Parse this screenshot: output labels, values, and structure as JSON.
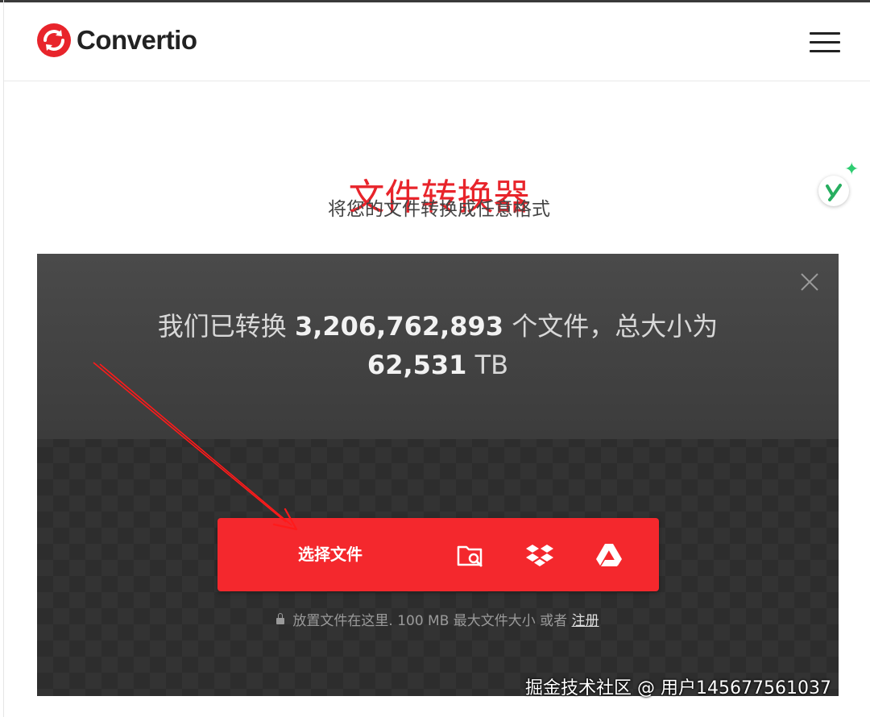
{
  "app": {
    "logo_text": "Convertio",
    "brand_color": "#e8242b"
  },
  "hero": {
    "title": "文件转换器",
    "subtitle": "将您的文件转换成任意格式"
  },
  "stats": {
    "prefix": "我们已转换",
    "files_count": "3,206,762,893",
    "middle": "个文件，总大小为",
    "size_value": "62,531",
    "size_unit": "TB"
  },
  "upload": {
    "choose_label": "选择文件",
    "icons": [
      "folder-search-icon",
      "dropbox-icon",
      "google-drive-icon"
    ],
    "hint_text": "放置文件在这里. 100 MB 最大文件大小 或者",
    "register_link": "注册"
  },
  "watermark": "掘金技术社区 @ 用户145677561037"
}
